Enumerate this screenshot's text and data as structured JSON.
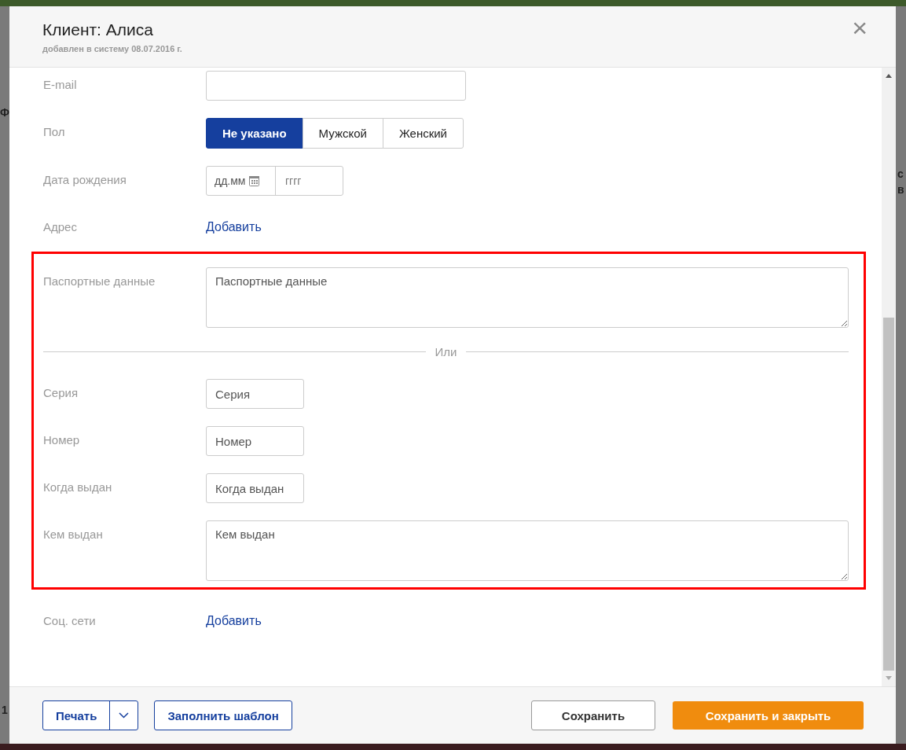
{
  "backdrop": {
    "fragments": [
      {
        "text": "Ф"
      },
      {
        "text": "с"
      },
      {
        "text": "в"
      },
      {
        "text": "1"
      }
    ]
  },
  "dialog": {
    "title": "Клиент: Алиса",
    "subtitle": "добавлен в систему 08.07.2016 г.",
    "close": "×"
  },
  "fields": [
    {
      "kind": "text",
      "label": "E-mail",
      "highlighted": false
    },
    {
      "kind": "segmented",
      "label": "Пол",
      "highlighted": false,
      "options": [
        {
          "label": "Не указано",
          "selected": true
        },
        {
          "label": "Мужской",
          "selected": false
        },
        {
          "label": "Женский",
          "selected": false
        }
      ]
    },
    {
      "kind": "date",
      "label": "Дата рождения",
      "highlighted": false,
      "day_placeholder": "дд.мм",
      "year_placeholder": "гггг"
    },
    {
      "kind": "link",
      "label": "Адрес",
      "highlighted": false,
      "link": "Добавить"
    },
    {
      "kind": "textarea",
      "label": "Паспортные данные",
      "highlighted": true,
      "placeholder": "Паспортные данные"
    },
    {
      "kind": "divider",
      "highlighted": true,
      "text": "Или"
    },
    {
      "kind": "text",
      "label": "Серия",
      "highlighted": true,
      "placeholder": "Серия"
    },
    {
      "kind": "text",
      "label": "Номер",
      "highlighted": true,
      "placeholder": "Номер"
    },
    {
      "kind": "text",
      "label": "Когда выдан",
      "highlighted": true,
      "placeholder": "Когда выдан"
    },
    {
      "kind": "textarea",
      "label": "Кем выдан",
      "highlighted": true,
      "placeholder": "Кем выдан"
    },
    {
      "kind": "link",
      "label": "Соц. сети",
      "highlighted": false,
      "link": "Добавить"
    }
  ],
  "footer": [
    {
      "kind": "split",
      "label": "Печать"
    },
    {
      "kind": "outline",
      "label": "Заполнить шаблон"
    },
    {
      "kind": "secondary",
      "label": "Сохранить"
    },
    {
      "kind": "primary",
      "label": "Сохранить и закрыть"
    }
  ]
}
